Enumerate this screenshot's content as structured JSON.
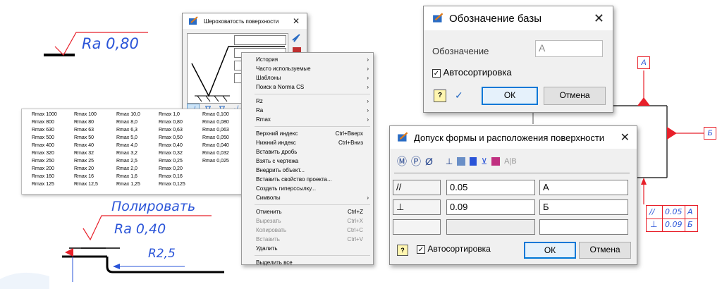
{
  "drawing": {
    "roughness_text": "Ra 0,80",
    "polish_text": "Полировать",
    "roughness2_text": "Ra 0,40",
    "radius_text": "R2,5",
    "base_label_a": "А",
    "base_label_b": "Б",
    "tol_rows": [
      {
        "sym": "//",
        "val": "0.05",
        "base": "А"
      },
      {
        "sym": "⊥",
        "val": "0.09",
        "base": "Б"
      }
    ]
  },
  "roughness_dialog": {
    "title": "Шероховатость поверхности"
  },
  "context_menu": {
    "items": [
      {
        "label": "История",
        "arrow": true
      },
      {
        "label": "Часто используемые",
        "arrow": true
      },
      {
        "label": "Шаблоны",
        "arrow": true
      },
      {
        "label": "Поиск в Norma CS",
        "arrow": true
      },
      {
        "sep": true
      },
      {
        "label": "Rz",
        "arrow": true
      },
      {
        "label": "Ra",
        "arrow": true
      },
      {
        "label": "Rmax",
        "arrow": true
      },
      {
        "sep": true
      },
      {
        "label": "Верхний индекс",
        "shortcut": "Ctrl+Вверх"
      },
      {
        "label": "Нижний индекс",
        "shortcut": "Ctrl+Вниз"
      },
      {
        "label": "Вставить дробь"
      },
      {
        "label": "Взять с чертежа"
      },
      {
        "label": "Внедрить объект..."
      },
      {
        "label": "Вставить свойство проекта..."
      },
      {
        "label": "Создать гиперссылку..."
      },
      {
        "label": "Символы",
        "arrow": true
      },
      {
        "sep": true
      },
      {
        "label": "Отменить",
        "shortcut": "Ctrl+Z"
      },
      {
        "label": "Вырезать",
        "shortcut": "Ctrl+X",
        "disabled": true
      },
      {
        "label": "Копировать",
        "shortcut": "Ctrl+C",
        "disabled": true
      },
      {
        "label": "Вставить",
        "shortcut": "Ctrl+V",
        "disabled": true
      },
      {
        "label": "Удалить"
      },
      {
        "sep": true
      },
      {
        "label": "Выделить все"
      }
    ]
  },
  "rmax_table": {
    "columns": [
      [
        "Rmax 1000",
        "Rmax 800",
        "Rmax 630",
        "Rmax 500",
        "Rmax 400",
        "Rmax 320",
        "Rmax 250",
        "Rmax 200",
        "Rmax 160",
        "Rmax 125"
      ],
      [
        "Rmax 100",
        "Rmax 80",
        "Rmax 63",
        "Rmax 50",
        "Rmax 40",
        "Rmax 32",
        "Rmax 25",
        "Rmax 20",
        "Rmax 16",
        "Rmax 12,5"
      ],
      [
        "Rmax 10,0",
        "Rmax 8,0",
        "Rmax 6,3",
        "Rmax 5,0",
        "Rmax 4,0",
        "Rmax 3,2",
        "Rmax 2,5",
        "Rmax 2,0",
        "Rmax 1,6",
        "Rmax 1,25"
      ],
      [
        "Rmax 1,0",
        "Rmax 0,80",
        "Rmax 0,63",
        "Rmax 0,50",
        "Rmax 0,40",
        "Rmax 0,32",
        "Rmax 0,25",
        "Rmax 0,20",
        "Rmax 0,16",
        "Rmax 0,125"
      ],
      [
        "Rmax 0,100",
        "Rmax 0,080",
        "Rmax 0,063",
        "Rmax 0,050",
        "Rmax 0,040",
        "Rmax 0,032",
        "Rmax 0,025"
      ]
    ]
  },
  "base_dialog": {
    "title": "Обозначение базы",
    "label": "Обозначение",
    "value": "А",
    "autosort": "Автосортировка",
    "ok": "ОК",
    "cancel": "Отмена"
  },
  "tolerance_dialog": {
    "title": "Допуск формы и расположения поверхности",
    "toolbar_icons": [
      "Ⓜ",
      "Ⓟ",
      "Ø"
    ],
    "ab_label": "A|B",
    "rows": [
      {
        "sym": "//",
        "value": "0.05",
        "base": "А"
      },
      {
        "sym": "⊥",
        "value": "0.09",
        "base": "Б"
      },
      {
        "sym": "",
        "value": "",
        "base": ""
      }
    ],
    "autosort": "Автосортировка",
    "ok": "ОК",
    "cancel": "Отмена"
  },
  "colors": {
    "cad_blue": "#2a54d8",
    "cad_red": "#e8202a",
    "accent": "#0078d7"
  }
}
